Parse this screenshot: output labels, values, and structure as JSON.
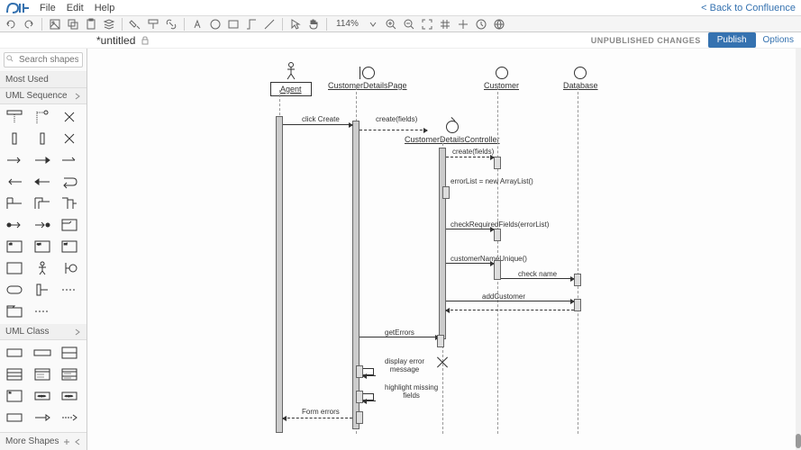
{
  "header": {
    "menu": [
      "File",
      "Edit",
      "Help"
    ],
    "back_link": "< Back to Confluence"
  },
  "toolbar": {
    "zoom": "114%"
  },
  "title_bar": {
    "title": "*untitled",
    "status": "UNPUBLISHED CHANGES",
    "publish_btn": "Publish",
    "options": "Options"
  },
  "sidebar": {
    "search_placeholder": "Search shapes",
    "sections": {
      "most_used": "Most Used",
      "uml_sequence": "UML Sequence",
      "uml_class": "UML Class"
    },
    "footer": "More Shapes"
  },
  "diagram": {
    "lifelines": {
      "agent": "Agent",
      "details_page": "CustomerDetailsPage",
      "details_controller": "CustomerDetailsController",
      "customer": "Customer",
      "database": "Database"
    },
    "messages": {
      "click_create": "click Create",
      "create_fields1": "create(fields)",
      "create_fields2": "create(fields)",
      "error_list": "errorList = new ArrayList()",
      "check_required": "checkRequiredFields(errorList)",
      "customer_name_unique": "customerNameUnique()",
      "check_name": "check name",
      "add_customer": "addCustomer",
      "get_errors": "getErrors",
      "display_error": "display error\nmessage",
      "highlight_missing": "highlight missing\nfields",
      "form_errors": "Form errors"
    }
  }
}
